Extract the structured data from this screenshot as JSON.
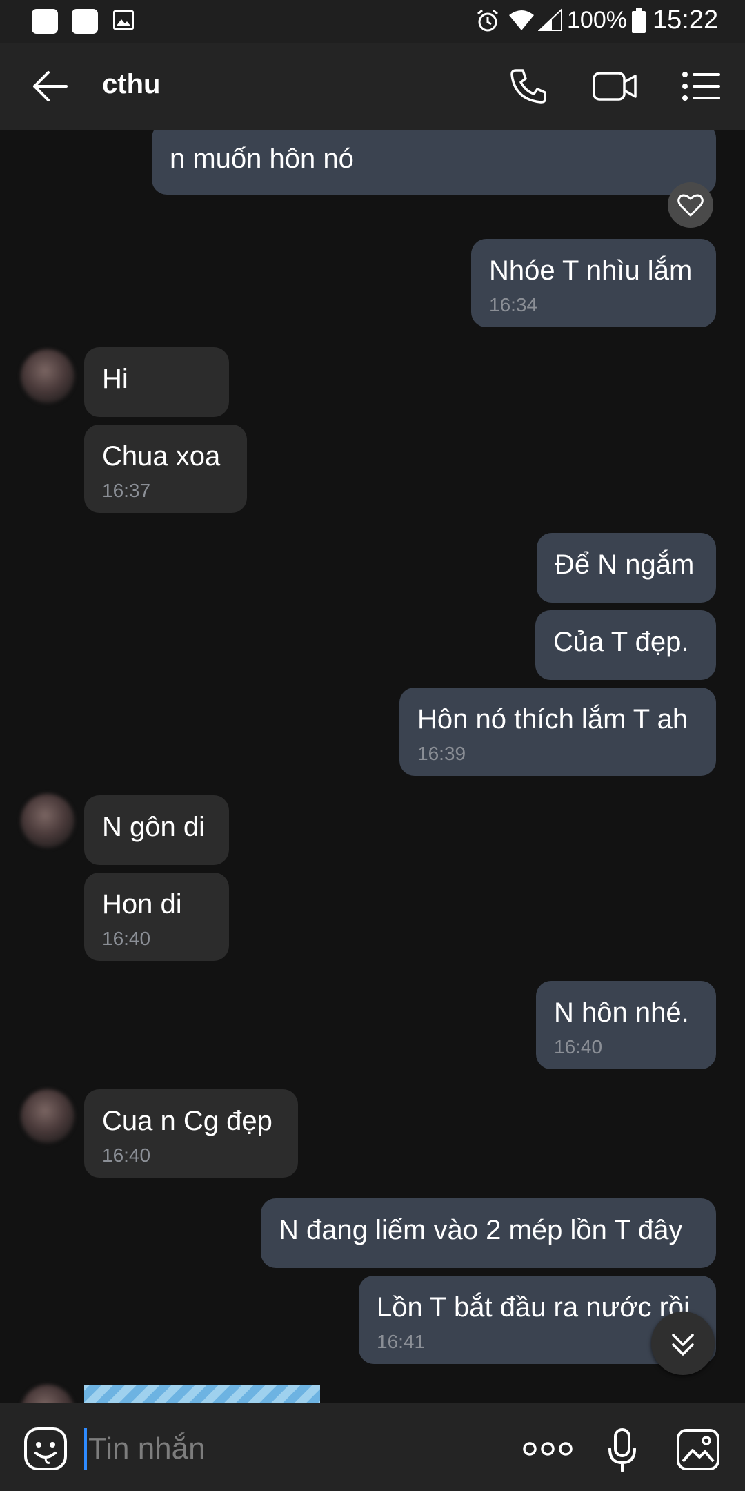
{
  "status_bar": {
    "battery": "100%",
    "time": "15:22"
  },
  "header": {
    "title": "cthu"
  },
  "messages": [
    {
      "text": "n muốn hôn nó",
      "time": ""
    },
    {
      "text": "Nhóe T nhìu lắm",
      "time": "16:34"
    },
    {
      "text": "Hi",
      "time": ""
    },
    {
      "text": "Chua xoa",
      "time": "16:37"
    },
    {
      "text": "Để N ngắm",
      "time": ""
    },
    {
      "text": "Của T đẹp.",
      "time": ""
    },
    {
      "text": "Hôn nó thích lắm T ah",
      "time": "16:39"
    },
    {
      "text": "N gôn di",
      "time": ""
    },
    {
      "text": "Hon di",
      "time": "16:40"
    },
    {
      "text": "N hôn nhé.",
      "time": "16:40"
    },
    {
      "text": "Cua n Cg đẹp",
      "time": "16:40"
    },
    {
      "text": "N đang liếm vào 2 mép lồn T đây",
      "time": ""
    },
    {
      "text": "Lồn T bắt đầu ra nước rồi",
      "time": "16:41"
    }
  ],
  "input": {
    "placeholder": "Tin nhắn"
  },
  "icons": {
    "back": "arrow-left-icon",
    "call": "phone-icon",
    "video": "video-camera-icon",
    "menu": "list-menu-icon",
    "react": "heart-icon",
    "scroll": "double-chevron-down-icon",
    "emoji": "sticker-smile-icon",
    "more": "more-dots-icon",
    "mic": "microphone-icon",
    "gallery": "image-gallery-icon"
  },
  "colors": {
    "outgoing_bubble": "#3b4350",
    "incoming_bubble": "#2c2c2c",
    "background": "#121212",
    "accent": "#2e8bff"
  }
}
